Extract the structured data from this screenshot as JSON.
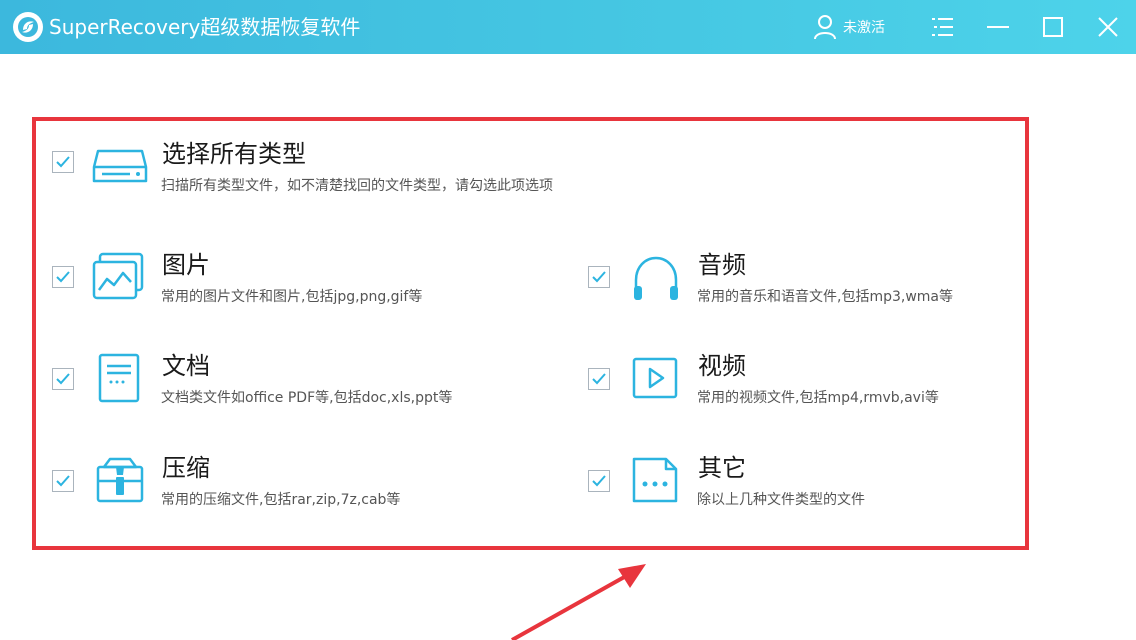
{
  "window": {
    "title": "SuperRecovery超级数据恢复软件",
    "user_status": "未激活",
    "logo_icon": "app-logo-icon",
    "titlebar_gradient": [
      "#3cb8dd",
      "#4dd3ea"
    ]
  },
  "colors": {
    "accent": "#2cb4e0",
    "highlight_frame": "#e8353d",
    "text_primary": "#1a1a1a",
    "text_secondary": "#555555"
  },
  "options": {
    "all": {
      "title": "选择所有类型",
      "desc": "扫描所有类型文件，如不清楚找回的文件类型，请勾选此项选项",
      "checked": true,
      "icon": "drive-icon"
    },
    "images": {
      "title": "图片",
      "desc": "常用的图片文件和图片,包括jpg,png,gif等",
      "checked": true,
      "icon": "image-icon"
    },
    "audio": {
      "title": "音频",
      "desc": "常用的音乐和语音文件,包括mp3,wma等",
      "checked": true,
      "icon": "headphones-icon"
    },
    "documents": {
      "title": "文档",
      "desc": "文档类文件如office PDF等,包括doc,xls,ppt等",
      "checked": true,
      "icon": "document-icon"
    },
    "video": {
      "title": "视频",
      "desc": "常用的视频文件,包括mp4,rmvb,avi等",
      "checked": true,
      "icon": "video-play-icon"
    },
    "archives": {
      "title": "压缩",
      "desc": "常用的压缩文件,包括rar,zip,7z,cab等",
      "checked": true,
      "icon": "archive-icon"
    },
    "other": {
      "title": "其它",
      "desc": "除以上几种文件类型的文件",
      "checked": true,
      "icon": "other-file-icon"
    }
  }
}
